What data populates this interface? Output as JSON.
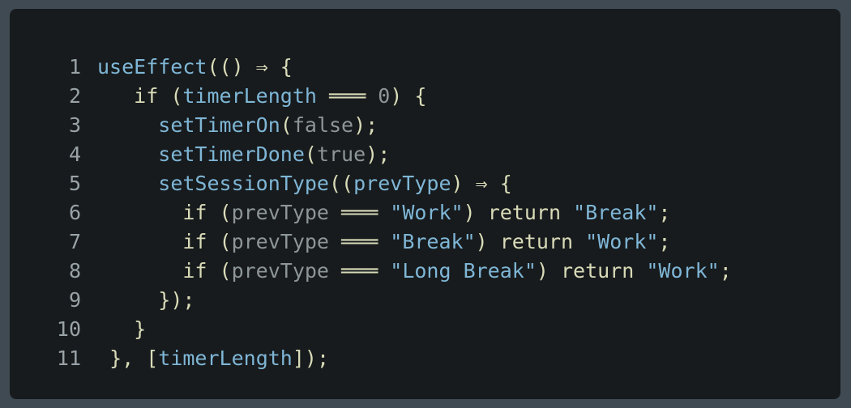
{
  "editor": {
    "lines": [
      {
        "no": "1",
        "tokens": [
          {
            "t": "useEffect",
            "k": "fn"
          },
          {
            "t": "(() ⇒ {",
            "k": "punc"
          }
        ]
      },
      {
        "no": "2",
        "tokens": [
          {
            "t": "   ",
            "k": "ws"
          },
          {
            "t": "if",
            "k": "kw"
          },
          {
            "t": " (",
            "k": "punc"
          },
          {
            "t": "timerLength",
            "k": "var"
          },
          {
            "t": " ═══ ",
            "k": "op"
          },
          {
            "t": "0",
            "k": "lit"
          },
          {
            "t": ") {",
            "k": "punc"
          }
        ]
      },
      {
        "no": "3",
        "tokens": [
          {
            "t": "     ",
            "k": "ws"
          },
          {
            "t": "setTimerOn",
            "k": "fn"
          },
          {
            "t": "(",
            "k": "punc"
          },
          {
            "t": "false",
            "k": "lit"
          },
          {
            "t": ");",
            "k": "punc"
          }
        ]
      },
      {
        "no": "4",
        "tokens": [
          {
            "t": "     ",
            "k": "ws"
          },
          {
            "t": "setTimerDone",
            "k": "fn"
          },
          {
            "t": "(",
            "k": "punc"
          },
          {
            "t": "true",
            "k": "lit"
          },
          {
            "t": ");",
            "k": "punc"
          }
        ]
      },
      {
        "no": "5",
        "tokens": [
          {
            "t": "     ",
            "k": "ws"
          },
          {
            "t": "setSessionType",
            "k": "fn"
          },
          {
            "t": "((",
            "k": "punc"
          },
          {
            "t": "prevType",
            "k": "var"
          },
          {
            "t": ") ⇒ {",
            "k": "punc"
          }
        ]
      },
      {
        "no": "6",
        "tokens": [
          {
            "t": "       ",
            "k": "ws"
          },
          {
            "t": "if",
            "k": "kw"
          },
          {
            "t": " (",
            "k": "punc"
          },
          {
            "t": "prevType",
            "k": "lit"
          },
          {
            "t": " ═══ ",
            "k": "op"
          },
          {
            "t": "\"Work\"",
            "k": "str"
          },
          {
            "t": ") ",
            "k": "punc"
          },
          {
            "t": "return",
            "k": "kw"
          },
          {
            "t": " ",
            "k": "ws"
          },
          {
            "t": "\"Break\"",
            "k": "str"
          },
          {
            "t": ";",
            "k": "punc"
          }
        ]
      },
      {
        "no": "7",
        "tokens": [
          {
            "t": "       ",
            "k": "ws"
          },
          {
            "t": "if",
            "k": "kw"
          },
          {
            "t": " (",
            "k": "punc"
          },
          {
            "t": "prevType",
            "k": "lit"
          },
          {
            "t": " ═══ ",
            "k": "op"
          },
          {
            "t": "\"Break\"",
            "k": "str"
          },
          {
            "t": ") ",
            "k": "punc"
          },
          {
            "t": "return",
            "k": "kw"
          },
          {
            "t": " ",
            "k": "ws"
          },
          {
            "t": "\"Work\"",
            "k": "str"
          },
          {
            "t": ";",
            "k": "punc"
          }
        ]
      },
      {
        "no": "8",
        "tokens": [
          {
            "t": "       ",
            "k": "ws"
          },
          {
            "t": "if",
            "k": "kw"
          },
          {
            "t": " (",
            "k": "punc"
          },
          {
            "t": "prevType",
            "k": "lit"
          },
          {
            "t": " ═══ ",
            "k": "op"
          },
          {
            "t": "\"Long Break\"",
            "k": "str"
          },
          {
            "t": ") ",
            "k": "punc"
          },
          {
            "t": "return",
            "k": "kw"
          },
          {
            "t": " ",
            "k": "ws"
          },
          {
            "t": "\"Work\"",
            "k": "str"
          },
          {
            "t": ";",
            "k": "punc"
          }
        ]
      },
      {
        "no": "9",
        "tokens": [
          {
            "t": "     ",
            "k": "ws"
          },
          {
            "t": "});",
            "k": "punc"
          }
        ]
      },
      {
        "no": "10",
        "tokens": [
          {
            "t": "   ",
            "k": "ws"
          },
          {
            "t": "}",
            "k": "punc"
          }
        ]
      },
      {
        "no": "11",
        "tokens": [
          {
            "t": " ",
            "k": "ws"
          },
          {
            "t": "}, [",
            "k": "punc"
          },
          {
            "t": "timerLength",
            "k": "var"
          },
          {
            "t": "]);",
            "k": "punc"
          }
        ]
      }
    ]
  },
  "colors": {
    "background": "#3f4a52",
    "panel": "#171b1d",
    "identifier": "#7fb6d6",
    "keyword": "#d9dbb8",
    "muted": "#8e9698",
    "line_number": "#99a2a7"
  }
}
